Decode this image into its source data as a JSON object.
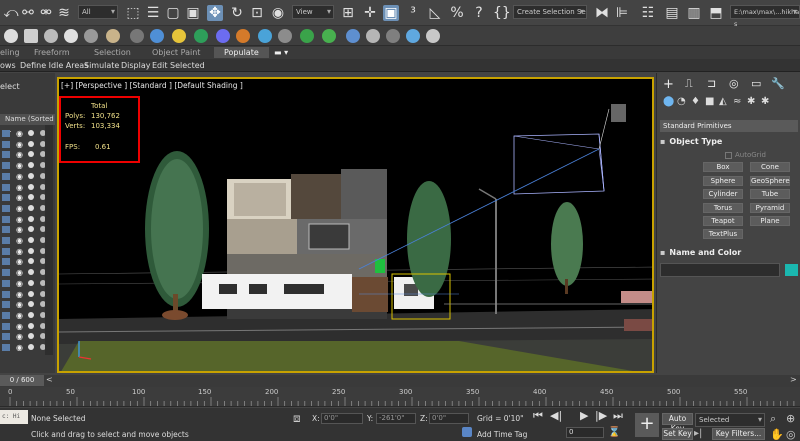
{
  "toolbar": {
    "filter_dropdown": "All",
    "view_dropdown": "View",
    "selection_set_dropdown": "Create Selection Se",
    "path_field": "E:\\max\\max\\...hikha s"
  },
  "ribbon": {
    "tabs": [
      "eling",
      "Freeform",
      "Selection",
      "Object Paint",
      "Populate"
    ],
    "active_tab": "Populate",
    "items": [
      "ows",
      "Define Idle Areas",
      "Simulate",
      "Display",
      "Edit Selected"
    ]
  },
  "scene_explorer": {
    "select_label": "elect",
    "sort_header": "Name (Sorted ..."
  },
  "viewport": {
    "label": "[+] [Perspective ] [Standard ] [Default Shading ]",
    "stats": {
      "total_label": "Total",
      "polys_label": "Polys:",
      "polys_value": "130,762",
      "verts_label": "Verts:",
      "verts_value": "103,334",
      "fps_label": "FPS:",
      "fps_value": "0.61"
    }
  },
  "command_panel": {
    "dropdown": "Standard Primitives",
    "object_type_header": "Object Type",
    "autogrid_label": "AutoGrid",
    "primitives": [
      "Box",
      "Cone",
      "Sphere",
      "GeoSphere",
      "Cylinder",
      "Tube",
      "Torus",
      "Pyramid",
      "Teapot",
      "Plane",
      "TextPlus"
    ],
    "name_color_header": "Name and Color"
  },
  "timeline": {
    "frame_readout": "0 / 600",
    "ticks": [
      "0",
      "50",
      "100",
      "150",
      "200",
      "250",
      "300",
      "350",
      "400",
      "450",
      "500",
      "550"
    ]
  },
  "status_bar": {
    "input_text": "c: Hi",
    "selection_status": "None Selected",
    "prompt": "Click and drag to select and move objects",
    "x_label": "X:",
    "x_value": "0'0\"",
    "y_label": "Y:",
    "y_value": "-261'0\"",
    "z_label": "Z:",
    "z_value": "0'0\"",
    "grid_label": "Grid = 0'10\"",
    "add_time_tag": "Add Time Tag",
    "frame_value": "0",
    "auto_key": "Auto Key",
    "selected_dropdown": "Selected",
    "set_key": "Set Key",
    "key_filters": "Key Filters..."
  },
  "colors": {
    "viewport_border": "#c8a200",
    "stats_highlight": "#e00000",
    "stats_text": "#f0e08a",
    "object_color": "#1bb8b0",
    "accent_blue": "#5ab0e6"
  }
}
